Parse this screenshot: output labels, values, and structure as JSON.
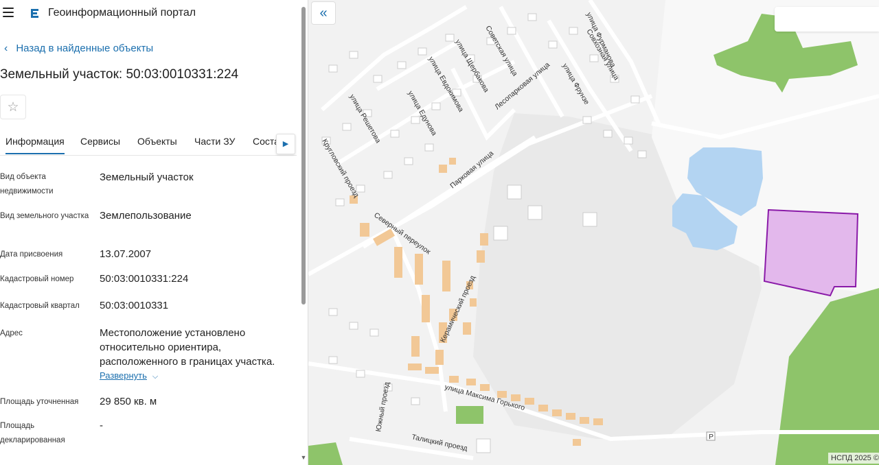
{
  "header": {
    "app_title": "Геоинформационный портал",
    "menu_icon": "hamburger-menu-icon",
    "logo_icon": "portal-logo-icon"
  },
  "back_link": "Назад в найденные объекты",
  "page_title": "Земельный участок: 50:03:0010331:224",
  "favorite_icon": "star-outline-icon",
  "tabs": [
    {
      "label": "Информация",
      "active": true
    },
    {
      "label": "Сервисы"
    },
    {
      "label": "Объекты"
    },
    {
      "label": "Части ЗУ"
    },
    {
      "label": "Соста"
    }
  ],
  "details": [
    {
      "label": "Вид объекта недвижимости",
      "value": "Земельный участок"
    },
    {
      "label": "Вид земельного участка",
      "value": "Землепользование"
    },
    {
      "label": "Дата присвоения",
      "value": "13.07.2007"
    },
    {
      "label": "Кадастровый номер",
      "value": "50:03:0010331:224"
    },
    {
      "label": "Кадастровый квартал",
      "value": "50:03:0010331"
    },
    {
      "label": "Адрес",
      "value": "Местоположение установлено относительно ориентира, расположенного в границах участка."
    },
    {
      "label": "Площадь уточненная",
      "value": "29 850 кв. м"
    },
    {
      "label": "Площадь декларированная",
      "value": "-"
    }
  ],
  "expand_link": "Развернуть",
  "map": {
    "collapse_icon": "double-chevron-left-icon",
    "attribution": "НСПД 2025 ©",
    "parking_label": "P",
    "streets": [
      "Советская улица",
      "улица Щербакова",
      "улица Евдокимова",
      "улица Едунова",
      "улица Решетова",
      "Лесопарковая улица",
      "улица Фрунзе",
      "Совхозная улица",
      "улица Фурманова",
      "Парковая улица",
      "Северный переулок",
      "Керамический проезд",
      "улица Максима Горького",
      "Южный проезд",
      "Талицкий проезд",
      "Кругловский проезд"
    ],
    "colors": {
      "background": "#f2f2f2",
      "water": "#b3d4f2",
      "green": "#8ec46a",
      "parcel_fill": "#e3b8ec",
      "parcel_stroke": "#8a1aa8",
      "building": "#ffffff",
      "orange_building": "#f2c896"
    }
  }
}
